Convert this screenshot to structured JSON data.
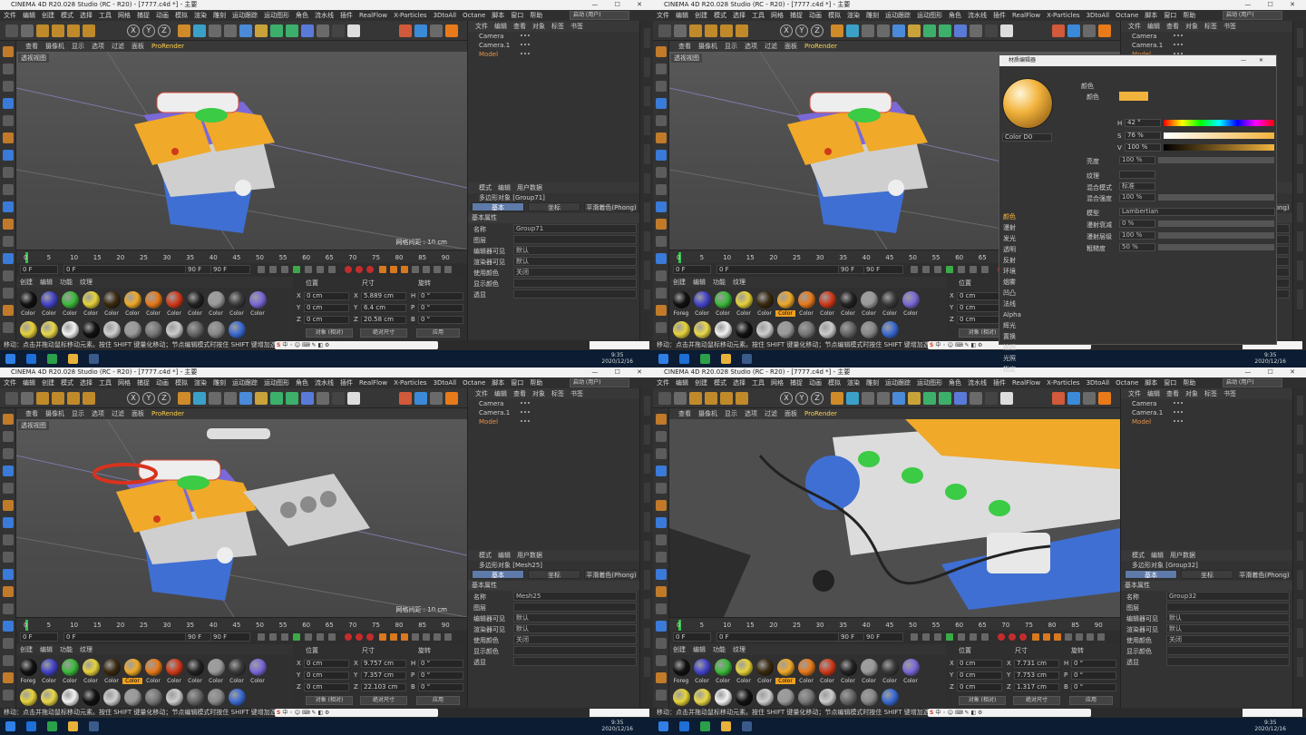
{
  "app": {
    "window_title": "CINEMA 4D R20.028 Studio (RC - R20) - [7777.c4d *] - 主要",
    "menus": [
      "文件",
      "编辑",
      "创建",
      "模式",
      "选择",
      "工具",
      "网格",
      "捕捉",
      "动画",
      "模拟",
      "渲染",
      "雕刻",
      "运动跟踪",
      "运动图形",
      "角色",
      "流水线",
      "插件",
      "RealFlow",
      "X-Particles",
      "3DtoAll",
      "Octane",
      "脚本",
      "窗口",
      "帮助"
    ],
    "layout_label": "界面",
    "layout_value": "启动 (用户)",
    "viewport_menu": [
      "查看",
      "摄像机",
      "显示",
      "选项",
      "过滤",
      "面板"
    ],
    "prorender": "ProRender",
    "viewport_label": "透视视图",
    "grid_spacing": "网格间距 : 10 cm",
    "timeline_ticks": [
      "0",
      "5",
      "10",
      "15",
      "20",
      "25",
      "30",
      "35",
      "40",
      "45",
      "50",
      "55",
      "60",
      "65",
      "70",
      "75",
      "80",
      "85",
      "90"
    ],
    "frame_start": "0 F",
    "frame_current": "0 F",
    "frame_end": "90 F",
    "frame_end2": "90 F",
    "material_tabs": [
      "创建",
      "编辑",
      "功能",
      "纹理"
    ],
    "material_label": "Color",
    "material_label_first": "Foreg",
    "coord_headers": [
      "位置",
      "尺寸",
      "旋转"
    ],
    "coord_mode": "对象 (相对)",
    "coord_size_mode": "绝对尺寸",
    "apply_btn": "应用",
    "object_manager_tabs": [
      "文件",
      "编辑",
      "查看",
      "对象",
      "标签",
      "书签"
    ],
    "objects": [
      "Camera",
      "Camera.1",
      "Model"
    ],
    "attr_tabs": [
      "模式",
      "编辑",
      "用户数据"
    ],
    "attr_subtabs": [
      "基本",
      "坐标",
      "平滑着色(Phong)"
    ],
    "attr_section": "基本属性",
    "attr_rows": [
      {
        "label": "名称",
        "value": ""
      },
      {
        "label": "图层",
        "value": ""
      },
      {
        "label": "编辑器可见",
        "value": "默认"
      },
      {
        "label": "渲染器可见",
        "value": "默认"
      },
      {
        "label": "使用颜色",
        "value": "关闭"
      },
      {
        "label": "显示颜色",
        "value": ""
      },
      {
        "label": "透显",
        "value": ""
      }
    ],
    "status_text": "移动：点击并拖动鼠标移动元素。按住 SHIFT 键量化移动；节点编辑模式时按住 SHIFT 键增加选择对象；按住 CTRL 键减少选择对象。",
    "ime_text": "中 ◦ ☺ ⌨ ✎ ◧ ⚙",
    "clock_time": "9:35",
    "clock_date": "2020/12/16"
  },
  "quadrants": [
    {
      "object_title": "多边形对象 [Group71]",
      "name_value": "Group71",
      "pos": [
        "0 cm",
        "0 cm",
        "0 cm"
      ],
      "size": [
        "5.889 cm",
        "6.4 cm",
        "20.58 cm"
      ],
      "rot": [
        "0 °",
        "0 °",
        "0 °"
      ]
    },
    {
      "object_title": "多边形对象 [Group71]",
      "name_value": "Group71",
      "pos": [
        "0 cm",
        "0 cm",
        "0 cm"
      ],
      "size": [
        "5.889 cm",
        "6.4 cm",
        "20.58 cm"
      ],
      "rot": [
        "0 °",
        "0 °",
        "0 °"
      ]
    },
    {
      "object_title": "多边形对象 [Mesh25]",
      "name_value": "Mesh25",
      "pos": [
        "0 cm",
        "0 cm",
        "0 cm"
      ],
      "size": [
        "9.757 cm",
        "7.357 cm",
        "22.103 cm"
      ],
      "rot": [
        "0 °",
        "0 °",
        "0 °"
      ]
    },
    {
      "object_title": "多边形对象 [Group32]",
      "name_value": "Group32",
      "pos": [
        "0 cm",
        "0 cm",
        "0 cm"
      ],
      "size": [
        "7.731 cm",
        "7.753 cm",
        "1.317 cm"
      ],
      "rot": [
        "0 °",
        "0 °",
        "0 °"
      ]
    }
  ],
  "material_editor": {
    "title": "材质编辑器",
    "material_name": "Color D0",
    "section": "颜色",
    "color_label": "颜色",
    "color_hex": "#f2b33d",
    "h_label": "H",
    "h_value": "42 °",
    "s_label": "S",
    "s_value": "76 %",
    "v_label": "V",
    "v_value": "100 %",
    "brightness_label": "亮度",
    "brightness_value": "100 %",
    "texture_label": "纹理",
    "mix_mode_label": "混合模式",
    "mix_mode_value": "标准",
    "mix_strength_label": "混合强度",
    "mix_strength_value": "100 %",
    "model_label": "模型",
    "model_value": "Lambertian",
    "diffuse_falloff_label": "漫射衰减",
    "diffuse_falloff_value": "0 %",
    "diffuse_level_label": "漫射层级",
    "diffuse_level_value": "100 %",
    "roughness_label": "粗糙度",
    "roughness_value": "50 %",
    "channels": [
      "颜色",
      "漫射",
      "发光",
      "透明",
      "反射",
      "环境",
      "烟雾",
      "凹凸",
      "法线",
      "Alpha",
      "辉光",
      "置换",
      "编辑",
      "光照",
      "指定"
    ]
  },
  "colors": {
    "accent_orange": "#f2a72e",
    "engine_yellow": "#f0a928",
    "engine_blue": "#3f6fd2",
    "engine_purple": "#7a69d8",
    "engine_green": "#3bcb45",
    "selection_blue": "#5e7aa8"
  }
}
